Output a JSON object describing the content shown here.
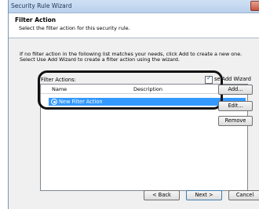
{
  "window": {
    "title": "Security Rule Wizard"
  },
  "header": {
    "title": "Filter Action",
    "subtitle": "Select the filter action for this security rule."
  },
  "instructions": "If no filter action in the following list matches your needs, click Add to create a new one.\nSelect Use Add Wizard to create a filter action using the wizard.",
  "filter_actions": {
    "label": "Filter Actions:",
    "columns": [
      "Name",
      "Description"
    ],
    "rows": [
      {
        "name": "New Filter Action",
        "description": "",
        "selected": true
      }
    ]
  },
  "use_add_wizard": {
    "label": "se Add Wizard",
    "checked": true
  },
  "buttons": {
    "add": "Add...",
    "edit": "Edit...",
    "remove": "Remove",
    "back": "< Back",
    "next": "Next >",
    "cancel": "Cancel"
  },
  "colors": {
    "selection": "#3399ff",
    "highlight_outline": "#111111"
  }
}
